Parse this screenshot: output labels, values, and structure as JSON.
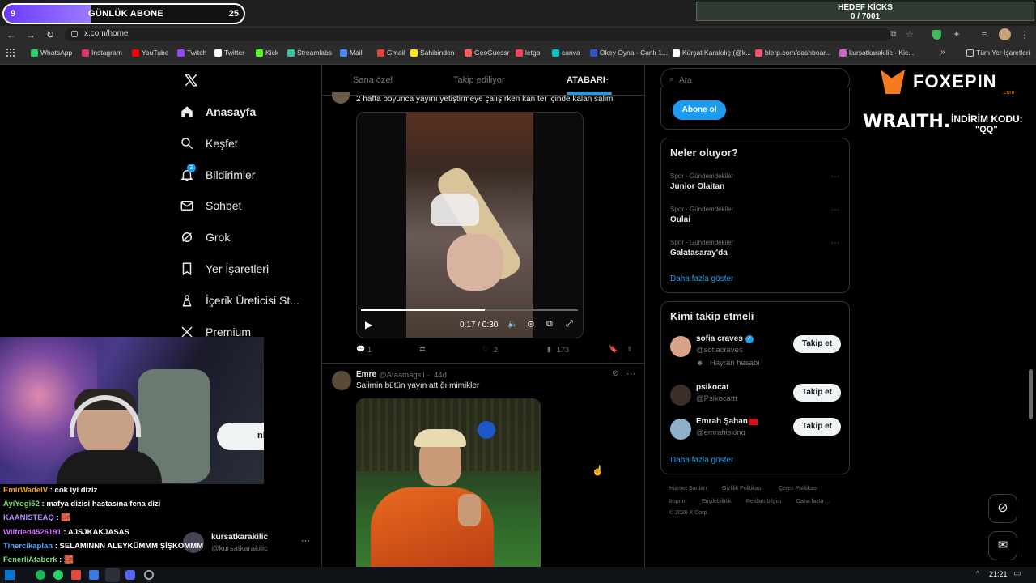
{
  "browser": {
    "url": "x.com/home",
    "bookmarks": [
      {
        "label": "WhatsApp",
        "icon": "whatsapp-icon",
        "color": "#25d366"
      },
      {
        "label": "Instagram",
        "icon": "instagram-icon",
        "color": "#e1306c"
      },
      {
        "label": "YouTube",
        "icon": "youtube-icon",
        "color": "#ff0000"
      },
      {
        "label": "Twitch",
        "icon": "twitch-icon",
        "color": "#9146ff"
      },
      {
        "label": "Twitter",
        "icon": "x-icon",
        "color": "#ffffff"
      },
      {
        "label": "Kick",
        "icon": "kick-icon",
        "color": "#53fc18"
      },
      {
        "label": "Streamlabs",
        "icon": "streamlabs-icon",
        "color": "#31c3a2"
      },
      {
        "label": "Mail",
        "icon": "mail-icon",
        "color": "#4a8cff"
      },
      {
        "label": "Gmail",
        "icon": "gmail-icon",
        "color": "#ea4335"
      },
      {
        "label": "Sahibinden",
        "icon": "sahibinden-icon",
        "color": "#ffe800"
      },
      {
        "label": "GeoGuessr",
        "icon": "geoguessr-icon",
        "color": "#ff5a5a"
      },
      {
        "label": "letgo",
        "icon": "letgo-icon",
        "color": "#ff3f55"
      },
      {
        "label": "canva",
        "icon": "canva-icon",
        "color": "#00c4cc"
      },
      {
        "label": "Okey Oyna - Canlı 1...",
        "icon": "okey-icon",
        "color": "#3355cc"
      },
      {
        "label": "Kürşat Karakılıç (@k...",
        "icon": "tiktok-icon",
        "color": "#ffffff"
      },
      {
        "label": "blerp.com/dashboar...",
        "icon": "blerp-icon",
        "color": "#ff4f6f"
      },
      {
        "label": "kursatkarakilic - Kic...",
        "icon": "kick-icon",
        "color": "#cc66cc"
      }
    ],
    "all_bookmarks": "Tüm Yer İşaretleri"
  },
  "overlay": {
    "sub_count": "9",
    "sub_label": "GÜNLÜK ABONE",
    "sub_goal": "25",
    "sub_progress": 0.36,
    "kicks_title": "HEDEF KİCKS",
    "kicks_value": "0 / 7001",
    "sponsor": "FOXEPIN",
    "sponsor_sub": ".com",
    "wraith": "WRAITH.",
    "discount_label": "İNDİRİM KODU:",
    "discount_code": "\"QQ\""
  },
  "nav": {
    "items": [
      {
        "label": "Anasayfa",
        "icon": "home-icon"
      },
      {
        "label": "Keşfet",
        "icon": "search-icon"
      },
      {
        "label": "Bildirimler",
        "icon": "bell-icon",
        "badge": "2"
      },
      {
        "label": "Sohbet",
        "icon": "mail-icon"
      },
      {
        "label": "Grok",
        "icon": "grok-icon"
      },
      {
        "label": "Yer İşaretleri",
        "icon": "bookmark-icon"
      },
      {
        "label": "İçerik Üreticisi St...",
        "icon": "creator-icon"
      },
      {
        "label": "Premium",
        "icon": "x-icon"
      }
    ],
    "post_button": "nla",
    "account_name": "kursatkarakilic",
    "account_handle": "@kursatkarakilic"
  },
  "feed": {
    "tabs": [
      "Sana özel",
      "Takip ediliyor",
      "ATABARI"
    ],
    "post1": {
      "text": "2 hafta boyunca yayını yetiştirmeye çalışırken kan ter içinde kalan salim",
      "video_time": "0:17 / 0:30",
      "video_progress": 0.57,
      "replies": "1",
      "likes": "2",
      "views": "173"
    },
    "post2": {
      "name": "Emre",
      "handle": "@Ataamagsli",
      "age": "44d",
      "text": "Salimin bütün yayın attığı mimikler"
    }
  },
  "sidebar": {
    "search_placeholder": "Ara",
    "subscribe": "Abone ol",
    "trends_title": "Neler oluyor?",
    "trends": [
      {
        "meta": "Spor · Gündemdekiler",
        "title": "Junior Olaitan"
      },
      {
        "meta": "Spor · Gündemdekiler",
        "title": "Oulai"
      },
      {
        "meta": "Spor · Gündemdekiler",
        "title": "Galatasaray'da"
      }
    ],
    "show_more": "Daha fazla göster",
    "follow_title": "Kimi takip etmeli",
    "follow": [
      {
        "name": "sofia craves",
        "handle": "@sofiacraves",
        "extra": "Hayran hesabı",
        "avatar_color": "#d9a38a"
      },
      {
        "name": "psikocat",
        "handle": "@Psikocattt",
        "extra": "",
        "avatar_color": "#3a2e2a"
      },
      {
        "name": "Emrah Şahan",
        "handle": "@emrahisking",
        "extra": "",
        "avatar_color": "#8fb0c8"
      }
    ],
    "follow_button": "Takip et",
    "footer": [
      "Hizmet Şartları",
      "Gizlilik Politikası",
      "Çerez Politikası",
      "Imprint",
      "Erişilebilirlik",
      "Reklam bilgisi",
      "Daha fazla ...",
      "© 2026 X Corp."
    ]
  },
  "chat": [
    {
      "user": "EmirWadelV",
      "msg": "cok iyi diziz",
      "color": "#f0a030"
    },
    {
      "user": "AyiYogi52",
      "msg": "mafya dizisi hastasına fena dizi",
      "color": "#6de06d"
    },
    {
      "user": "KAANISTEAQ",
      "msg": "🧱",
      "color": "#b18cff"
    },
    {
      "user": "Wilfried4526191",
      "msg": "AJSJKAKJASAS",
      "color": "#d46cff"
    },
    {
      "user": "Tinercikaplan",
      "msg": "SELAMINNN ALEYKÜMMM ŞİŞKOMMM",
      "color": "#58a6ff"
    },
    {
      "user": "FenerliAtaberk",
      "msg": "🧱",
      "color": "#7fe07f"
    }
  ],
  "taskbar": {
    "time": "21:21"
  }
}
